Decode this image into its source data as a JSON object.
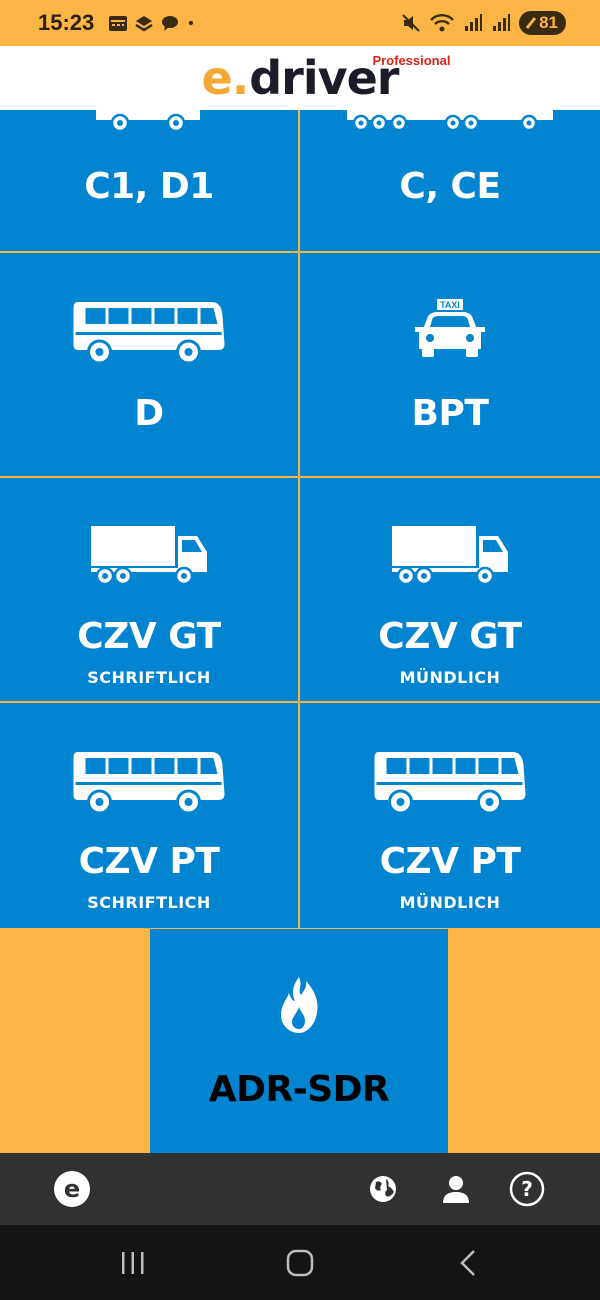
{
  "status_bar": {
    "time": "15:23",
    "battery": "81",
    "left_icons": [
      "calendar-icon",
      "stack-icon",
      "chat-bubble-icon",
      "dot-icon"
    ],
    "right_icons": [
      "mute-icon",
      "wifi-icon",
      "signal-icon",
      "signal-icon",
      "battery-icon"
    ]
  },
  "header": {
    "logo_e": "e",
    "logo_dot": ".",
    "logo_driver": "driver",
    "logo_badge": "Professional"
  },
  "tiles": [
    {
      "title": "C1, D1",
      "subtitle": "",
      "icon": "truck-icon"
    },
    {
      "title": "C, CE",
      "subtitle": "",
      "icon": "truck-trailer-icon"
    },
    {
      "title": "D",
      "subtitle": "",
      "icon": "bus-icon"
    },
    {
      "title": "BPT",
      "subtitle": "",
      "icon": "taxi-icon"
    },
    {
      "title": "CZV GT",
      "subtitle": "SCHRIFTLICH",
      "icon": "truck-icon"
    },
    {
      "title": "CZV GT",
      "subtitle": "MÜNDLICH",
      "icon": "truck-icon"
    },
    {
      "title": "CZV PT",
      "subtitle": "SCHRIFTLICH",
      "icon": "bus-icon"
    },
    {
      "title": "CZV PT",
      "subtitle": "MÜNDLICH",
      "icon": "bus-icon"
    }
  ],
  "adr": {
    "title": "ADR-SDR",
    "icon": "flame-icon"
  },
  "taxi_sign": "TAXI",
  "toolbar": {
    "home_icon": "e-logo-icon",
    "icons": [
      "globe-icon",
      "user-icon",
      "help-icon"
    ]
  },
  "navbar": {
    "icons": [
      "recent-apps-icon",
      "home-icon",
      "back-icon"
    ]
  },
  "colors": {
    "accent_orange": "#FBB545",
    "tile_blue": "#0384D1",
    "toolbar_dark": "#313131",
    "logo_red": "#D9241C"
  }
}
